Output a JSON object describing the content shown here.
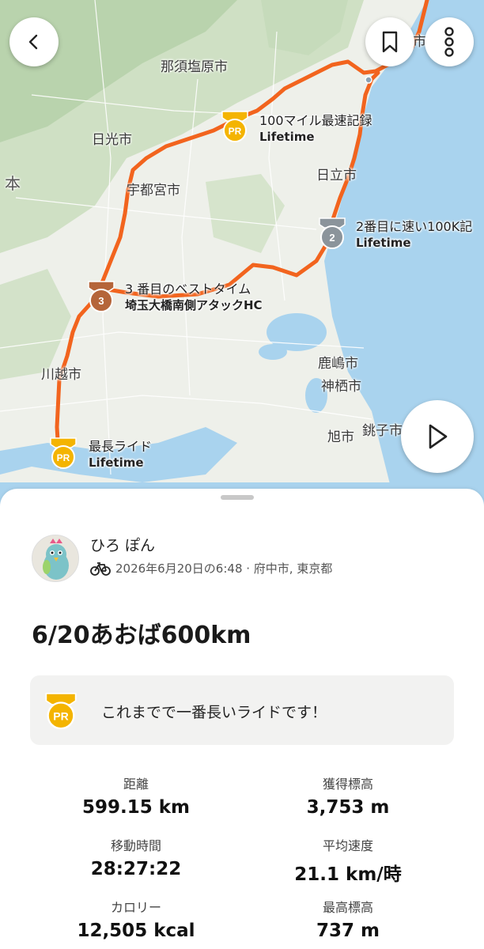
{
  "map": {
    "places": {
      "nasushiobara": "那須塩原市",
      "nikko": "日光市",
      "utsunomiya": "宇都宮市",
      "hitachi": "日立市",
      "kawagoe": "川越市",
      "kashima": "鹿嶋市",
      "kamisu": "神栖市",
      "asahi": "旭市",
      "choshi": "銚子市",
      "hon": "本",
      "top_right": "市"
    },
    "segments": [
      {
        "badge": "PR",
        "title": "100マイル最速記録",
        "subtitle": "Lifetime"
      },
      {
        "badge": "2",
        "title": "2番目に速い100K記",
        "subtitle": "Lifetime"
      },
      {
        "badge": "3",
        "title": "3 番目のベストタイム",
        "subtitle": "埼玉大橋南側アタックHC"
      },
      {
        "badge": "PR",
        "title": "最長ライド",
        "subtitle": "Lifetime"
      }
    ],
    "route_color": "#f2641e"
  },
  "buttons": {
    "back": "back-icon",
    "bookmark": "bookmark-icon",
    "more": "more-vertical-icon",
    "play": "play-icon"
  },
  "athlete": {
    "name": "ひろ ぽん",
    "meta": "2026年6月20日の6:48 · 府中市, 東京都"
  },
  "activity": {
    "title": "6/20あおば600km"
  },
  "achievement": {
    "badge": "PR",
    "text": "これまでで一番長いライドです！"
  },
  "stats": [
    {
      "label": "距離",
      "value": "599.15 km"
    },
    {
      "label": "獲得標高",
      "value": "3,753 m"
    },
    {
      "label": "移動時間",
      "value": "28:27:22"
    },
    {
      "label": "平均速度",
      "value": "21.1 km/時"
    },
    {
      "label": "カロリー",
      "value": "12,505 kcal"
    },
    {
      "label": "最高標高",
      "value": "737 m"
    }
  ]
}
